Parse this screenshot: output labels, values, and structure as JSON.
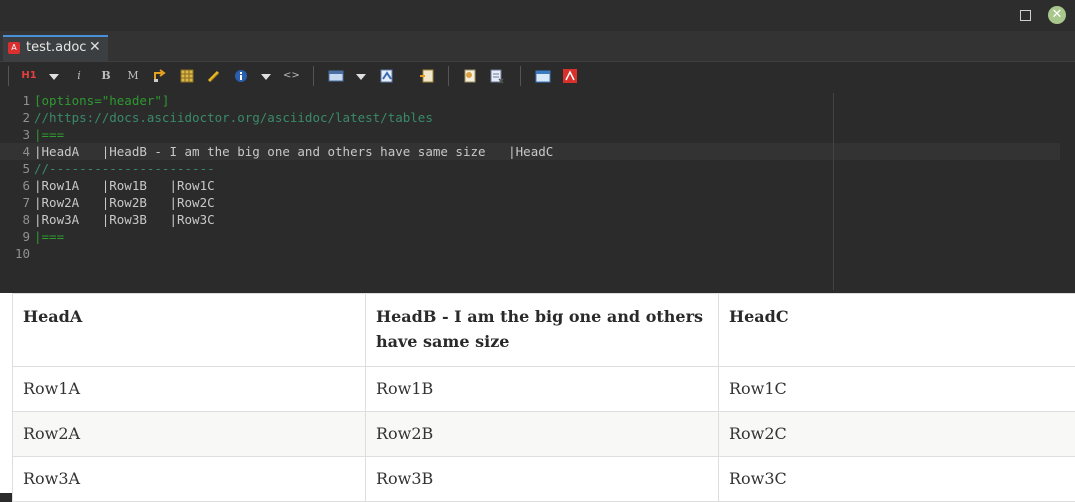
{
  "window": {
    "close_glyph": "✕"
  },
  "tab": {
    "label": "test.adoc",
    "close": "✕",
    "icon": "asciidoc-file-icon"
  },
  "toolbar": {
    "items": [
      "h1-icon",
      "italic-icon",
      "bold-icon",
      "monospace-icon",
      "link-icon",
      "table-icon",
      "attachment-icon",
      "info-icon",
      "code-icon",
      "block-icon",
      "image-icon",
      "include-icon",
      "preview-icon",
      "clear-icon",
      "browser-icon",
      "pdf-icon"
    ],
    "h1": "H1",
    "italic": "i",
    "bold": "B",
    "mono": "M",
    "code": "<>"
  },
  "editor": {
    "lines": [
      {
        "n": "1",
        "text": "[options=\"header\"]",
        "kind": "green"
      },
      {
        "n": "2",
        "text": "//https://docs.asciidoctor.org/asciidoc/latest/tables",
        "kind": "comment"
      },
      {
        "n": "3",
        "text": "|===",
        "kind": "green"
      },
      {
        "n": "4",
        "text": "|HeadA   |HeadB - I am the big one and others have same size   |HeadC",
        "kind": "text"
      },
      {
        "n": "5",
        "text": "//----------------------",
        "kind": "comment"
      },
      {
        "n": "6",
        "text": "|Row1A   |Row1B   |Row1C",
        "kind": "text"
      },
      {
        "n": "7",
        "text": "|Row2A   |Row2B   |Row2C",
        "kind": "text"
      },
      {
        "n": "8",
        "text": "|Row3A   |Row3B   |Row3C",
        "kind": "text"
      },
      {
        "n": "9",
        "text": "|===",
        "kind": "green"
      },
      {
        "n": "10",
        "text": "",
        "kind": "text"
      }
    ],
    "highlighted_line": 4
  },
  "preview": {
    "headers": [
      "HeadA",
      "HeadB - I am the big one and others have same size",
      "HeadC"
    ],
    "rows": [
      [
        "Row1A",
        "Row1B",
        "Row1C"
      ],
      [
        "Row2A",
        "Row2B",
        "Row2C"
      ],
      [
        "Row3A",
        "Row3B",
        "Row3C"
      ]
    ]
  }
}
